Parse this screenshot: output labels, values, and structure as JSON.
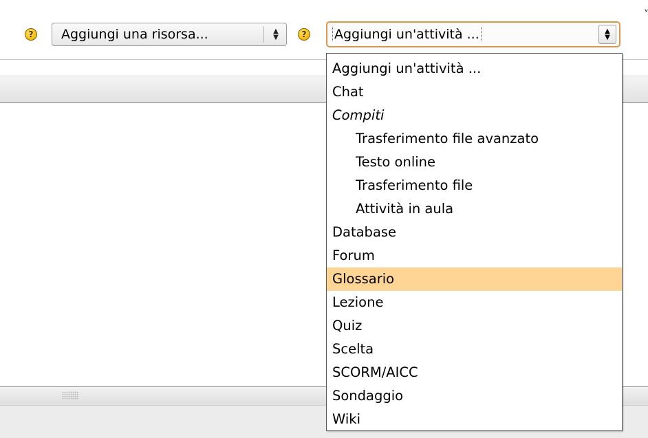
{
  "toolbar": {
    "corner_glyph": "˅",
    "help_icon_glyph": "?",
    "help_icon": "help-icon",
    "resource_select": {
      "value": "Aggiungi una risorsa...",
      "arrow_up": "▲",
      "arrow_down": "▼"
    },
    "activity_select": {
      "value": "Aggiungi un'attività ...",
      "arrow_up": "▲",
      "arrow_down": "▼",
      "focus_color": "#e0954a"
    }
  },
  "dropdown": {
    "highlight_color": "#ffd596",
    "options": [
      {
        "label": "Aggiungi un'attività ...",
        "kind": "option"
      },
      {
        "label": "Chat",
        "kind": "option"
      },
      {
        "label": "Compiti",
        "kind": "group"
      },
      {
        "label": "Trasferimento file avanzato",
        "kind": "suboption"
      },
      {
        "label": "Testo online",
        "kind": "suboption"
      },
      {
        "label": "Trasferimento file",
        "kind": "suboption"
      },
      {
        "label": "Attività in aula",
        "kind": "suboption"
      },
      {
        "label": "Database",
        "kind": "option"
      },
      {
        "label": "Forum",
        "kind": "option"
      },
      {
        "label": "Glossario",
        "kind": "option",
        "highlighted": true
      },
      {
        "label": "Lezione",
        "kind": "option"
      },
      {
        "label": "Quiz",
        "kind": "option"
      },
      {
        "label": "Scelta",
        "kind": "option"
      },
      {
        "label": "SCORM/AICC",
        "kind": "option"
      },
      {
        "label": "Sondaggio",
        "kind": "option"
      },
      {
        "label": "Wiki",
        "kind": "option"
      }
    ]
  }
}
